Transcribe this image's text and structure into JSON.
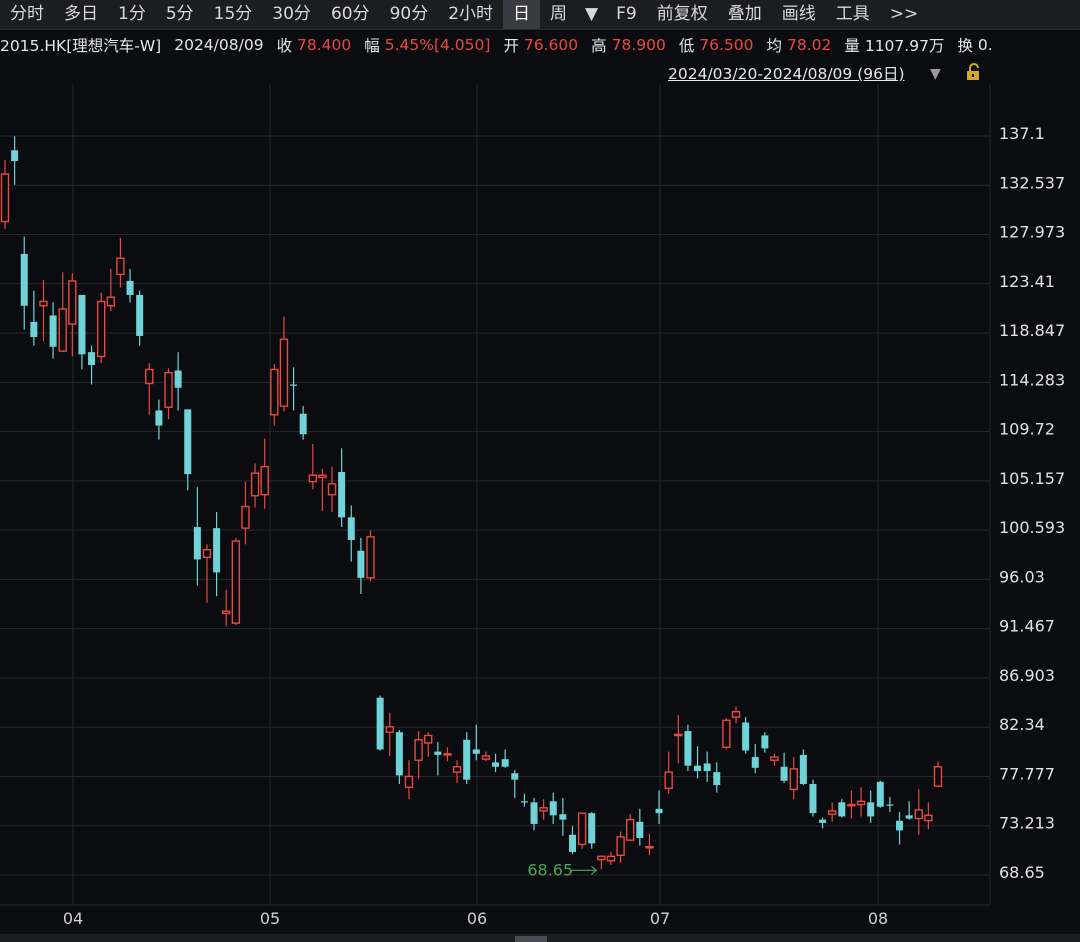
{
  "toolbar": {
    "periods": [
      "分时",
      "多日",
      "1分",
      "5分",
      "15分",
      "30分",
      "60分",
      "90分",
      "2小时",
      "日",
      "周"
    ],
    "active_period": "日",
    "actions": [
      "F9",
      "前复权",
      "叠加",
      "画线",
      "工具",
      ">>"
    ]
  },
  "quote": {
    "symbol": "2015.HK[理想汽车-W]",
    "date": "2024/08/09",
    "close_label": "收",
    "close": "78.400",
    "change_label": "幅",
    "change": "5.45%[4.050]",
    "open_label": "开",
    "open": "76.600",
    "high_label": "高",
    "high": "78.900",
    "low_label": "低",
    "low": "76.500",
    "avg_label": "均",
    "avg": "78.02",
    "volume_label": "量",
    "volume": "1107.97万",
    "turnover_label": "换",
    "turnover": "0."
  },
  "range_text": "2024/03/20-2024/08/09 (96日)",
  "colors": {
    "up": "#e8483f",
    "down": "#6fd3d8",
    "background": "#0b0c10",
    "grid": "#26272d",
    "annotation": "#4fa35a"
  },
  "chart_data": {
    "type": "candlestick",
    "y_ticks": [
      "137.1",
      "132.537",
      "127.973",
      "123.41",
      "118.847",
      "114.283",
      "109.72",
      "105.157",
      "100.593",
      "96.03",
      "91.467",
      "86.903",
      "82.34",
      "77.777",
      "73.213",
      "68.65"
    ],
    "ylim": [
      68.65,
      137.1
    ],
    "x_ticks": [
      "04",
      "05",
      "06",
      "07",
      "08"
    ],
    "annotation": "68.65",
    "candles": [
      {
        "o": 128.9,
        "h": 134.6,
        "l": 128.2,
        "c": 133.3
      },
      {
        "o": 135.5,
        "h": 136.8,
        "l": 132.3,
        "c": 134.5
      },
      {
        "o": 125.9,
        "h": 127.5,
        "l": 118.9,
        "c": 121.1
      },
      {
        "o": 119.6,
        "h": 122.5,
        "l": 117.4,
        "c": 118.2
      },
      {
        "o": 121.1,
        "h": 123.5,
        "l": 117.8,
        "c": 121.5
      },
      {
        "o": 120.2,
        "h": 121.4,
        "l": 116.2,
        "c": 117.3
      },
      {
        "o": 116.9,
        "h": 124.2,
        "l": 116.8,
        "c": 120.8
      },
      {
        "o": 119.4,
        "h": 124.1,
        "l": 116.4,
        "c": 123.4
      },
      {
        "o": 122.1,
        "h": 122.1,
        "l": 115.2,
        "c": 116.6
      },
      {
        "o": 116.8,
        "h": 117.4,
        "l": 113.8,
        "c": 115.6
      },
      {
        "o": 116.4,
        "h": 122.3,
        "l": 115.8,
        "c": 121.5
      },
      {
        "o": 121.1,
        "h": 124.5,
        "l": 120.6,
        "c": 121.9
      },
      {
        "o": 124.0,
        "h": 127.4,
        "l": 122.8,
        "c": 125.5
      },
      {
        "o": 123.4,
        "h": 124.5,
        "l": 121.4,
        "c": 122.1
      },
      {
        "o": 122.1,
        "h": 122.5,
        "l": 117.4,
        "c": 118.3
      },
      {
        "o": 113.9,
        "h": 115.8,
        "l": 111.0,
        "c": 115.2
      },
      {
        "o": 111.4,
        "h": 112.4,
        "l": 108.7,
        "c": 110.0
      },
      {
        "o": 111.7,
        "h": 115.3,
        "l": 110.6,
        "c": 114.9
      },
      {
        "o": 115.1,
        "h": 116.8,
        "l": 111.4,
        "c": 113.5
      },
      {
        "o": 111.5,
        "h": 111.5,
        "l": 104.0,
        "c": 105.5
      },
      {
        "o": 100.6,
        "h": 104.3,
        "l": 95.2,
        "c": 97.6
      },
      {
        "o": 97.8,
        "h": 99.0,
        "l": 93.6,
        "c": 98.5
      },
      {
        "o": 100.5,
        "h": 102.0,
        "l": 94.2,
        "c": 96.4
      },
      {
        "o": 92.6,
        "h": 94.8,
        "l": 91.4,
        "c": 92.8
      },
      {
        "o": 91.7,
        "h": 99.6,
        "l": 91.5,
        "c": 99.3
      },
      {
        "o": 100.5,
        "h": 104.8,
        "l": 99.0,
        "c": 102.5
      },
      {
        "o": 103.5,
        "h": 106.5,
        "l": 102.4,
        "c": 105.6
      },
      {
        "o": 103.6,
        "h": 108.8,
        "l": 102.3,
        "c": 106.2
      },
      {
        "o": 111.0,
        "h": 115.7,
        "l": 110.0,
        "c": 115.2
      },
      {
        "o": 111.8,
        "h": 120.1,
        "l": 111.3,
        "c": 118.0
      },
      {
        "o": 113.8,
        "h": 115.4,
        "l": 111.4,
        "c": 113.7
      },
      {
        "o": 111.1,
        "h": 111.8,
        "l": 108.7,
        "c": 109.2
      },
      {
        "o": 104.8,
        "h": 108.3,
        "l": 104.1,
        "c": 105.4
      },
      {
        "o": 105.2,
        "h": 106.0,
        "l": 102.1,
        "c": 105.4
      },
      {
        "o": 103.6,
        "h": 106.2,
        "l": 102.0,
        "c": 104.6
      },
      {
        "o": 105.7,
        "h": 107.9,
        "l": 100.6,
        "c": 101.5
      },
      {
        "o": 101.5,
        "h": 102.6,
        "l": 97.4,
        "c": 99.4
      },
      {
        "o": 98.4,
        "h": 99.6,
        "l": 94.4,
        "c": 95.9
      },
      {
        "o": 95.9,
        "h": 100.3,
        "l": 95.6,
        "c": 99.7
      },
      {
        "o": 84.8,
        "h": 85.0,
        "l": 79.9,
        "c": 80.0
      },
      {
        "o": 81.6,
        "h": 83.4,
        "l": 79.4,
        "c": 82.1
      },
      {
        "o": 81.6,
        "h": 81.8,
        "l": 76.8,
        "c": 77.6
      },
      {
        "o": 76.5,
        "h": 79.0,
        "l": 75.4,
        "c": 77.5
      },
      {
        "o": 79.0,
        "h": 81.7,
        "l": 77.3,
        "c": 80.9
      },
      {
        "o": 80.6,
        "h": 81.6,
        "l": 79.3,
        "c": 81.3
      },
      {
        "o": 79.8,
        "h": 80.7,
        "l": 77.6,
        "c": 79.5
      },
      {
        "o": 79.6,
        "h": 80.2,
        "l": 78.9,
        "c": 79.6
      },
      {
        "o": 77.9,
        "h": 79.0,
        "l": 76.9,
        "c": 78.4
      },
      {
        "o": 80.9,
        "h": 81.6,
        "l": 76.8,
        "c": 77.2
      },
      {
        "o": 80.0,
        "h": 82.3,
        "l": 79.0,
        "c": 79.6
      },
      {
        "o": 79.1,
        "h": 79.8,
        "l": 78.9,
        "c": 79.4
      },
      {
        "o": 78.8,
        "h": 79.6,
        "l": 77.9,
        "c": 78.4
      },
      {
        "o": 79.1,
        "h": 80.0,
        "l": 78.3,
        "c": 78.4
      },
      {
        "o": 77.8,
        "h": 78.1,
        "l": 75.5,
        "c": 77.2
      },
      {
        "o": 75.2,
        "h": 75.9,
        "l": 74.7,
        "c": 75.1
      },
      {
        "o": 75.1,
        "h": 75.5,
        "l": 72.5,
        "c": 73.1
      },
      {
        "o": 74.3,
        "h": 75.4,
        "l": 73.5,
        "c": 74.6
      },
      {
        "o": 75.2,
        "h": 76.0,
        "l": 73.1,
        "c": 73.9
      },
      {
        "o": 74.0,
        "h": 75.5,
        "l": 72.0,
        "c": 73.5
      },
      {
        "o": 72.1,
        "h": 72.9,
        "l": 70.3,
        "c": 70.5
      },
      {
        "o": 71.2,
        "h": 74.1,
        "l": 70.8,
        "c": 74.1
      },
      {
        "o": 74.1,
        "h": 74.2,
        "l": 70.8,
        "c": 71.3
      },
      {
        "o": 69.8,
        "h": 70.2,
        "l": 68.9,
        "c": 70.1
      },
      {
        "o": 69.7,
        "h": 70.5,
        "l": 69.3,
        "c": 70.1
      },
      {
        "o": 70.2,
        "h": 72.4,
        "l": 69.5,
        "c": 71.9
      },
      {
        "o": 71.6,
        "h": 74.0,
        "l": 71.5,
        "c": 73.5
      },
      {
        "o": 73.3,
        "h": 74.5,
        "l": 71.1,
        "c": 71.8
      },
      {
        "o": 71.0,
        "h": 72.2,
        "l": 70.2,
        "c": 71.0
      },
      {
        "o": 74.5,
        "h": 76.2,
        "l": 73.1,
        "c": 74.1
      },
      {
        "o": 76.4,
        "h": 79.8,
        "l": 75.9,
        "c": 77.9
      },
      {
        "o": 81.3,
        "h": 83.2,
        "l": 78.7,
        "c": 81.4
      },
      {
        "o": 81.7,
        "h": 82.3,
        "l": 78.0,
        "c": 78.5
      },
      {
        "o": 78.5,
        "h": 80.3,
        "l": 77.3,
        "c": 78.0
      },
      {
        "o": 78.7,
        "h": 79.8,
        "l": 77.0,
        "c": 78.0
      },
      {
        "o": 77.9,
        "h": 78.8,
        "l": 76.0,
        "c": 76.7
      },
      {
        "o": 80.2,
        "h": 82.9,
        "l": 80.0,
        "c": 82.7
      },
      {
        "o": 83.0,
        "h": 84.0,
        "l": 82.4,
        "c": 83.5
      },
      {
        "o": 82.5,
        "h": 83.0,
        "l": 79.6,
        "c": 79.9
      },
      {
        "o": 79.3,
        "h": 80.5,
        "l": 77.8,
        "c": 78.3
      },
      {
        "o": 81.3,
        "h": 81.6,
        "l": 79.7,
        "c": 80.1
      },
      {
        "o": 79.0,
        "h": 79.6,
        "l": 78.5,
        "c": 79.3
      },
      {
        "o": 78.4,
        "h": 79.7,
        "l": 76.9,
        "c": 77.1
      },
      {
        "o": 76.3,
        "h": 79.3,
        "l": 75.4,
        "c": 78.2
      },
      {
        "o": 79.5,
        "h": 80.0,
        "l": 76.7,
        "c": 76.8
      },
      {
        "o": 76.8,
        "h": 77.2,
        "l": 73.8,
        "c": 74.1
      },
      {
        "o": 73.5,
        "h": 73.7,
        "l": 72.7,
        "c": 73.2
      },
      {
        "o": 74.0,
        "h": 75.1,
        "l": 73.3,
        "c": 74.3
      },
      {
        "o": 75.1,
        "h": 75.4,
        "l": 73.7,
        "c": 73.8
      },
      {
        "o": 74.8,
        "h": 76.2,
        "l": 73.6,
        "c": 74.9
      },
      {
        "o": 74.9,
        "h": 76.5,
        "l": 73.8,
        "c": 75.2
      },
      {
        "o": 75.1,
        "h": 76.2,
        "l": 73.2,
        "c": 73.8
      },
      {
        "o": 77.0,
        "h": 77.1,
        "l": 74.6,
        "c": 74.7
      },
      {
        "o": 74.9,
        "h": 75.6,
        "l": 74.2,
        "c": 74.8
      },
      {
        "o": 73.4,
        "h": 74.2,
        "l": 71.2,
        "c": 72.5
      },
      {
        "o": 73.9,
        "h": 75.2,
        "l": 73.5,
        "c": 73.6
      },
      {
        "o": 73.6,
        "h": 76.3,
        "l": 72.1,
        "c": 74.4
      },
      {
        "o": 73.4,
        "h": 75.1,
        "l": 72.6,
        "c": 73.9
      },
      {
        "o": 76.6,
        "h": 78.9,
        "l": 76.5,
        "c": 78.4
      }
    ]
  }
}
